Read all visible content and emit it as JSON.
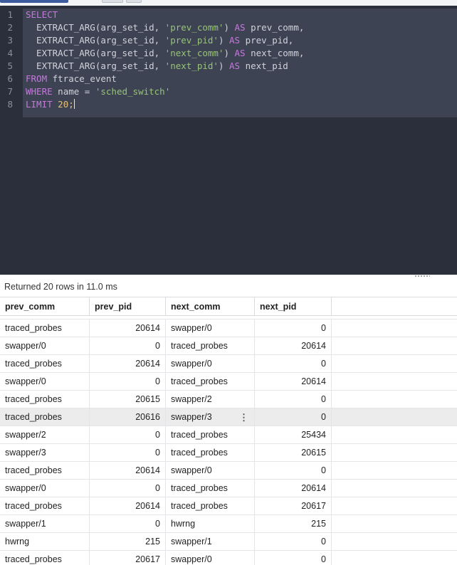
{
  "editor": {
    "lines": [
      {
        "num": "1",
        "tokens": [
          {
            "t": "SELECT",
            "c": "kw"
          }
        ]
      },
      {
        "num": "2",
        "tokens": [
          {
            "t": "  EXTRACT_ARG(arg_set_id, ",
            "c": "fn"
          },
          {
            "t": "'prev_comm'",
            "c": "str"
          },
          {
            "t": ") ",
            "c": "plain"
          },
          {
            "t": "AS",
            "c": "kw"
          },
          {
            "t": " prev_comm,",
            "c": "plain"
          }
        ]
      },
      {
        "num": "3",
        "tokens": [
          {
            "t": "  EXTRACT_ARG(arg_set_id, ",
            "c": "fn"
          },
          {
            "t": "'prev_pid'",
            "c": "str"
          },
          {
            "t": ") ",
            "c": "plain"
          },
          {
            "t": "AS",
            "c": "kw"
          },
          {
            "t": " prev_pid,",
            "c": "plain"
          }
        ]
      },
      {
        "num": "4",
        "tokens": [
          {
            "t": "  EXTRACT_ARG(arg_set_id, ",
            "c": "fn"
          },
          {
            "t": "'next_comm'",
            "c": "str"
          },
          {
            "t": ") ",
            "c": "plain"
          },
          {
            "t": "AS",
            "c": "kw"
          },
          {
            "t": " next_comm,",
            "c": "plain"
          }
        ]
      },
      {
        "num": "5",
        "tokens": [
          {
            "t": "  EXTRACT_ARG(arg_set_id, ",
            "c": "fn"
          },
          {
            "t": "'next_pid'",
            "c": "str"
          },
          {
            "t": ") ",
            "c": "plain"
          },
          {
            "t": "AS",
            "c": "kw"
          },
          {
            "t": " next_pid",
            "c": "plain"
          }
        ]
      },
      {
        "num": "6",
        "tokens": [
          {
            "t": "FROM",
            "c": "kw"
          },
          {
            "t": " ftrace_event",
            "c": "plain"
          }
        ]
      },
      {
        "num": "7",
        "tokens": [
          {
            "t": "WHERE",
            "c": "kw"
          },
          {
            "t": " name = ",
            "c": "plain"
          },
          {
            "t": "'sched_switch'",
            "c": "str"
          }
        ]
      },
      {
        "num": "8",
        "tokens": [
          {
            "t": "LIMIT",
            "c": "kw"
          },
          {
            "t": " ",
            "c": "plain"
          },
          {
            "t": "20",
            "c": "num"
          },
          {
            "t": ";",
            "c": "num"
          }
        ]
      }
    ]
  },
  "status": {
    "text": "Returned 20 rows in 11.0 ms"
  },
  "table": {
    "columns": [
      "prev_comm",
      "prev_pid",
      "next_comm",
      "next_pid"
    ],
    "rows": [
      [
        "traced_probes",
        "20614",
        "swapper/0",
        "0"
      ],
      [
        "swapper/0",
        "0",
        "traced_probes",
        "20614"
      ],
      [
        "traced_probes",
        "20614",
        "swapper/0",
        "0"
      ],
      [
        "swapper/0",
        "0",
        "traced_probes",
        "20614"
      ],
      [
        "traced_probes",
        "20615",
        "swapper/2",
        "0"
      ],
      [
        "traced_probes",
        "20616",
        "swapper/3",
        "0"
      ],
      [
        "swapper/2",
        "0",
        "traced_probes",
        "25434"
      ],
      [
        "swapper/3",
        "0",
        "traced_probes",
        "20615"
      ],
      [
        "traced_probes",
        "20614",
        "swapper/0",
        "0"
      ],
      [
        "swapper/0",
        "0",
        "traced_probes",
        "20614"
      ],
      [
        "traced_probes",
        "20614",
        "traced_probes",
        "20617"
      ],
      [
        "swapper/1",
        "0",
        "hwrng",
        "215"
      ],
      [
        "hwrng",
        "215",
        "swapper/1",
        "0"
      ],
      [
        "traced_probes",
        "20617",
        "swapper/0",
        "0"
      ]
    ],
    "highlighted_row": 5,
    "row_menu_icon": "kebab-menu-icon",
    "row_menu_glyph": "⋮"
  }
}
